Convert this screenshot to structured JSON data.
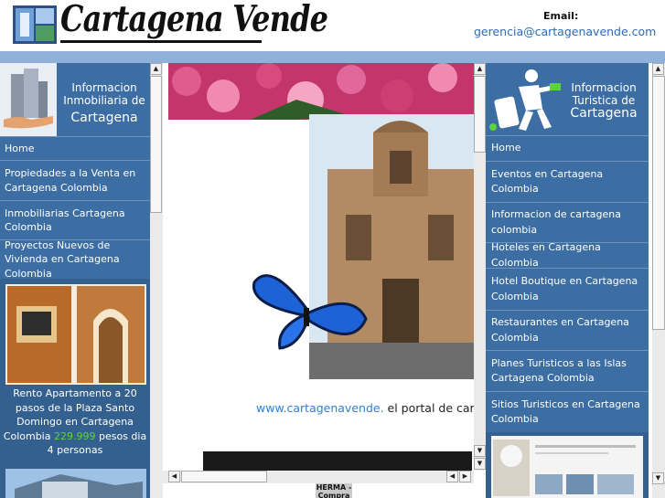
{
  "header": {
    "logo_text": "Cartagena Vende",
    "email_label": "Email:",
    "email": "gerencia@cartagenavende.com"
  },
  "left": {
    "banner_title": "Informacion Inmobiliaria de",
    "banner_city": "Cartagena",
    "nav": [
      {
        "label": "Home"
      },
      {
        "label": "Propiedades a la Venta en Cartagena Colombia"
      },
      {
        "label": "Inmobiliarias Cartagena Colombia"
      },
      {
        "label": "Proyectos Nuevos de Vivienda en Cartagena Colombia"
      }
    ],
    "promo": {
      "text_before": "Rento Apartamento a 20 pasos de la Plaza Santo Domingo en Cartagena Colombia",
      "price": "229.999",
      "text_after": "pesos dia 4 personas"
    }
  },
  "center": {
    "portal_link": "www.cartagenavende.",
    "portal_text": "el portal de cart",
    "herma_label": "HERMA - Compra"
  },
  "right": {
    "banner_title": "Informacion Turistica de",
    "banner_city": "Cartagena",
    "nav": [
      {
        "label": "Home"
      },
      {
        "label": "Eventos en Cartagena Colombia"
      },
      {
        "label": "Informacion de cartagena colombia"
      },
      {
        "label": "Hoteles en Cartagena Colombia"
      },
      {
        "label": "Hotel Boutique en Cartagena Colombia"
      },
      {
        "label": "Restaurantes en Cartagena Colombia"
      },
      {
        "label": "Planes Turisticos a las Islas Cartagena Colombia"
      },
      {
        "label": "Sitios Turisticos en Cartagena Colombia"
      }
    ]
  },
  "icons": {
    "up": "▲",
    "down": "▼",
    "left": "◀",
    "right": "▶"
  },
  "colors": {
    "nav_bg": "#3c6ea3",
    "link": "#2e6cb0",
    "price": "#5dd43a",
    "topbar": "#8fb0d9"
  }
}
